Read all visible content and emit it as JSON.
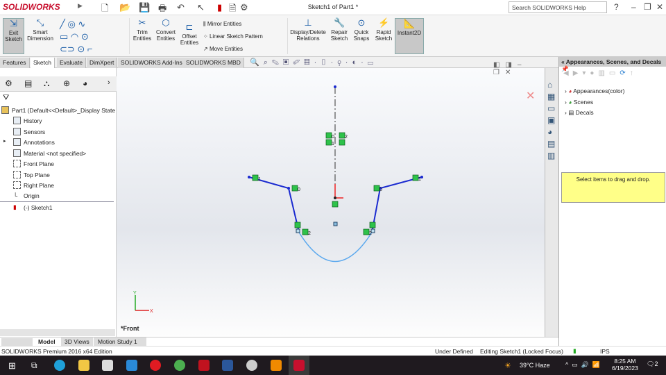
{
  "titlebar": {
    "logo": "SOLIDWORKS",
    "title": "Sketch1 of Part1 *",
    "search_placeholder": "Search SOLIDWORKS Help"
  },
  "ribbon": {
    "exit_sketch": "Exit Sketch",
    "smart_dimension": "Smart Dimension",
    "trim": "Trim Entities",
    "convert": "Convert Entities",
    "offset": "Offset Entities",
    "mirror": "Mirror Entities",
    "linear_pattern": "Linear Sketch Pattern",
    "move": "Move Entities",
    "display_delete": "Display/Delete Relations",
    "repair": "Repair Sketch",
    "quick_snaps": "Quick Snaps",
    "rapid": "Rapid Sketch",
    "instant2d": "Instant2D"
  },
  "tabs": [
    "Features",
    "Sketch",
    "Evaluate",
    "DimXpert",
    "SOLIDWORKS Add-Ins",
    "SOLIDWORKS MBD"
  ],
  "tree": {
    "root": "Part1  (Default<<Default>_Display State",
    "items": [
      "History",
      "Sensors",
      "Annotations",
      "Material <not specified>",
      "Front Plane",
      "Top Plane",
      "Right Plane",
      "Origin",
      "(-) Sketch1"
    ]
  },
  "view": {
    "name": "*Front",
    "axis_x": "X",
    "axis_y": "Y",
    "relation_labels": [
      "0",
      "2",
      "1",
      "1",
      "0",
      "0",
      "1",
      "2",
      "2"
    ]
  },
  "taskpane": {
    "title": "Appearances, Scenes, and Decals",
    "items": [
      "Appearances(color)",
      "Scenes",
      "Decals"
    ],
    "drag_hint": "Select items to drag and drop."
  },
  "bottom_tabs": [
    "Model",
    "3D Views",
    "Motion Study 1"
  ],
  "status": {
    "edition": "SOLIDWORKS Premium 2016 x64 Edition",
    "defined": "Under Defined",
    "editing": "Editing Sketch1 (Locked Focus)",
    "units": "IPS"
  },
  "taskbar": {
    "weather": "39°C  Haze",
    "time": "8:25 AM",
    "date": "6/19/2023",
    "notifications": "2"
  }
}
